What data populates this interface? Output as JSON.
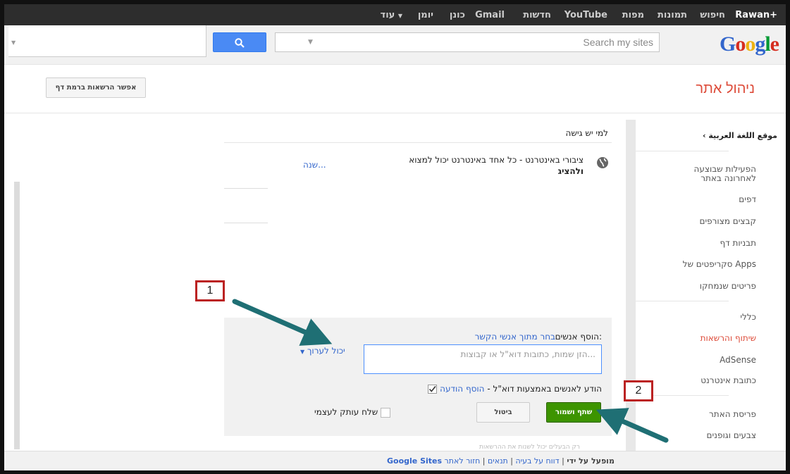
{
  "topbar": {
    "user": "Rawan+",
    "items": [
      "חיפוש",
      "תמונות",
      "מפות",
      "YouTube",
      "חדשות",
      "Gmail",
      "כונן",
      "יומן",
      "עוד"
    ]
  },
  "search": {
    "placeholder": "Search my sites",
    "logo": "Google"
  },
  "header": {
    "title": "ניהול אתר",
    "page_permissions_button": "אפשר הרשאות ברמת דף"
  },
  "sidebar": {
    "site_link": "موقع اللغة العربية",
    "items": [
      "הפעילות שבוצעה לאחרונה באתר",
      "דפים",
      "קבצים מצורפים",
      "תבניות דף",
      "סקריפטים של Apps",
      "פריטים שנמחקו",
      "כללי",
      "שיתוף והרשאות",
      "AdSense",
      "כתובת אינטרנט",
      "פריסת האתר",
      "צבעים וגופנים"
    ],
    "active_index": 7
  },
  "access": {
    "heading": "למי יש גישה",
    "public_text": "ציבורי באינטרנט - כל אחד באינטרנט יכול למצוא",
    "public_text_bold": "ולהציג",
    "change_link": "שנה..."
  },
  "add_people": {
    "label": "הוסף אנשים:",
    "contacts_link": "בחר מתוך אנשי הקשר",
    "placeholder": "הזן שמות, כתובות דוא\"ל או קבוצות...",
    "permission": "יכול לערוך",
    "notify_text": "הודע לאנשים באמצעות דוא\"ל -",
    "notify_link": "הוסף הודעה",
    "share_button": "שתף ושמור",
    "cancel_button": "ביטול",
    "copy_me": "שלח עותק לעצמי",
    "cutoff_text": "רק הבעלים יכול לשנות את ההרשאות"
  },
  "footer": {
    "back": "חזור לאתר",
    "terms": "תנאים",
    "report": "דווח על בעיה",
    "powered": "מופעל על ידי",
    "brand": "Google Sites"
  },
  "callouts": {
    "one": "1",
    "two": "2"
  },
  "colors": {
    "accent_red": "#dd4b39",
    "link_blue": "#3366cc",
    "share_green": "#3d9400",
    "arrow_teal": "#1f6f74"
  }
}
